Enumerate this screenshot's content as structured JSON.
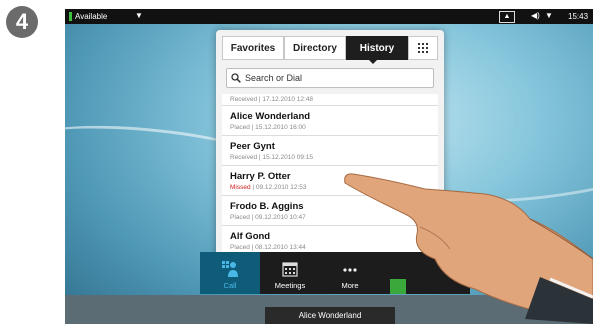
{
  "step_number": "4",
  "status_bar": {
    "availability": "Available",
    "time": "15:43"
  },
  "tabs": [
    {
      "label": "Favorites",
      "active": false
    },
    {
      "label": "Directory",
      "active": false
    },
    {
      "label": "History",
      "active": true
    }
  ],
  "search": {
    "placeholder": "Search or Dial"
  },
  "history": [
    {
      "name": "",
      "detail": "Received | 17.12.2010 12:48",
      "missed": false
    },
    {
      "name": "Alice Wonderland",
      "detail": "Placed | 15.12.2010 16:00",
      "missed": false
    },
    {
      "name": "Peer Gynt",
      "detail": "Received | 15.12.2010 09:15",
      "missed": false
    },
    {
      "name": "Harry P. Otter",
      "detail_prefix": "Missed",
      "detail": " | 09.12.2010 12:53",
      "missed": true
    },
    {
      "name": "Frodo B. Aggins",
      "detail": "Placed | 09.12.2010 10:47",
      "missed": false
    },
    {
      "name": "Alf Gond",
      "detail": "Placed | 08.12.2010 13:44",
      "missed": false
    }
  ],
  "dock": [
    {
      "label": "Call",
      "icon": "call-icon",
      "active": true
    },
    {
      "label": "Meetings",
      "icon": "calendar-icon",
      "active": false
    },
    {
      "label": "More",
      "icon": "more-icon",
      "active": false
    }
  ],
  "bottom_bar": {
    "name": "Alice Wonderland"
  },
  "colors": {
    "accent": "#4ab8e6",
    "missed": "#d02020",
    "available": "#3fbf3f"
  }
}
